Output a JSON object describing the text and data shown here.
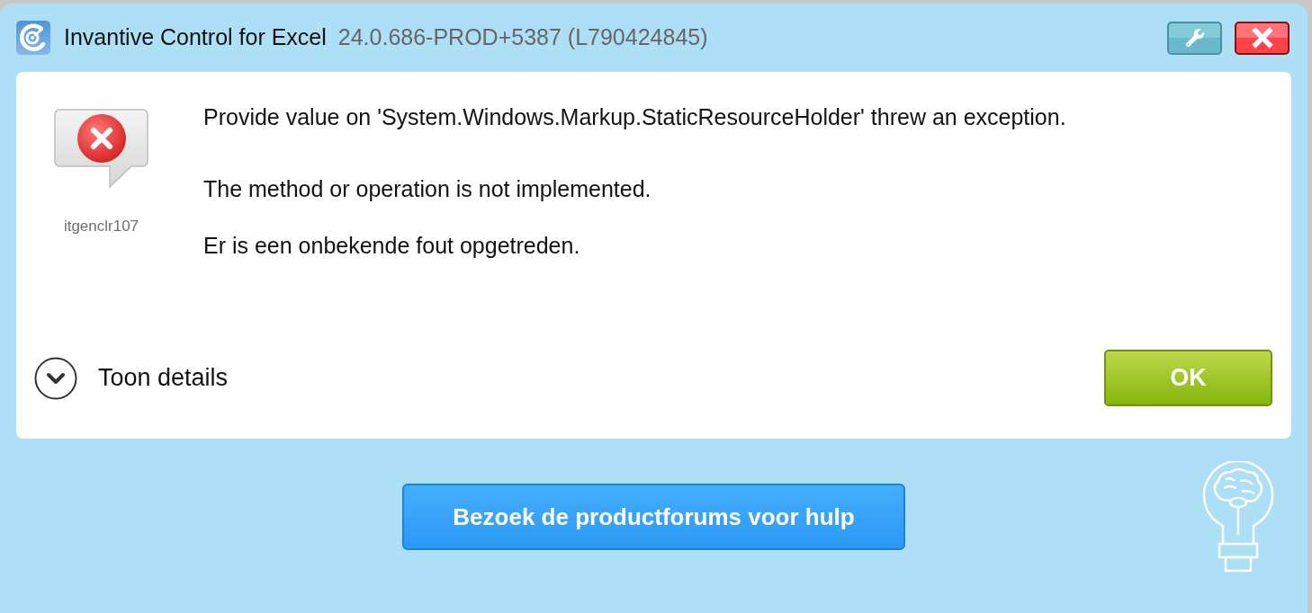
{
  "window": {
    "title": "Invantive Control for Excel",
    "version": "24.0.686-PROD+5387 (L790424845)"
  },
  "message": {
    "code": "itgenclr107",
    "lines": [
      "Provide value on 'System.Windows.Markup.StaticResourceHolder' threw an exception.",
      "The method or operation is not implemented.",
      "Er is een onbekende fout opgetreden."
    ]
  },
  "details": {
    "label": "Toon details",
    "expanded": false
  },
  "buttons": {
    "ok": "OK",
    "forum": "Bezoek de productforums voor hulp"
  }
}
